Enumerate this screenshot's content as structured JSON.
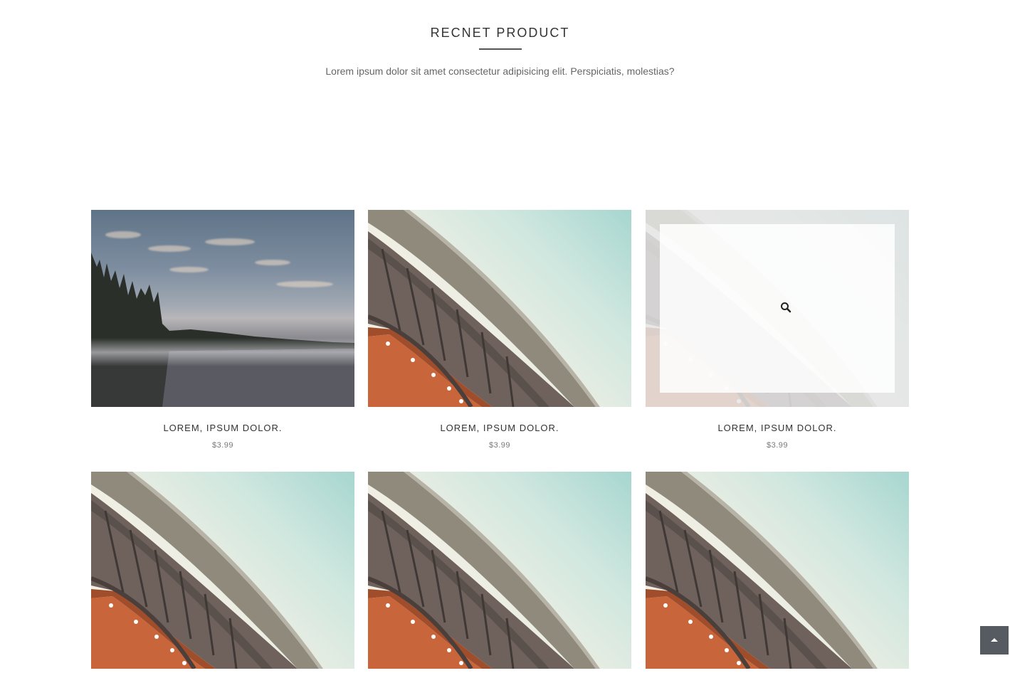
{
  "section": {
    "title": "RECNET PRODUCT",
    "subtitle": "Lorem ipsum dolor sit amet consectetur adipisicing elit. Perspiciatis, molestias?"
  },
  "products": [
    {
      "name": "LOREM, IPSUM DOLOR.",
      "price": "$3.99",
      "image": "lake-forest"
    },
    {
      "name": "LOREM, IPSUM DOLOR.",
      "price": "$3.99",
      "image": "building-curve"
    },
    {
      "name": "LOREM, IPSUM DOLOR.",
      "price": "$3.99",
      "image": "building-curve",
      "hovered": true,
      "overlay_icon": "search-icon"
    },
    {
      "image": "building-curve"
    },
    {
      "image": "building-curve"
    },
    {
      "image": "building-curve"
    }
  ],
  "back_to_top": {
    "icon": "caret-up-icon"
  }
}
